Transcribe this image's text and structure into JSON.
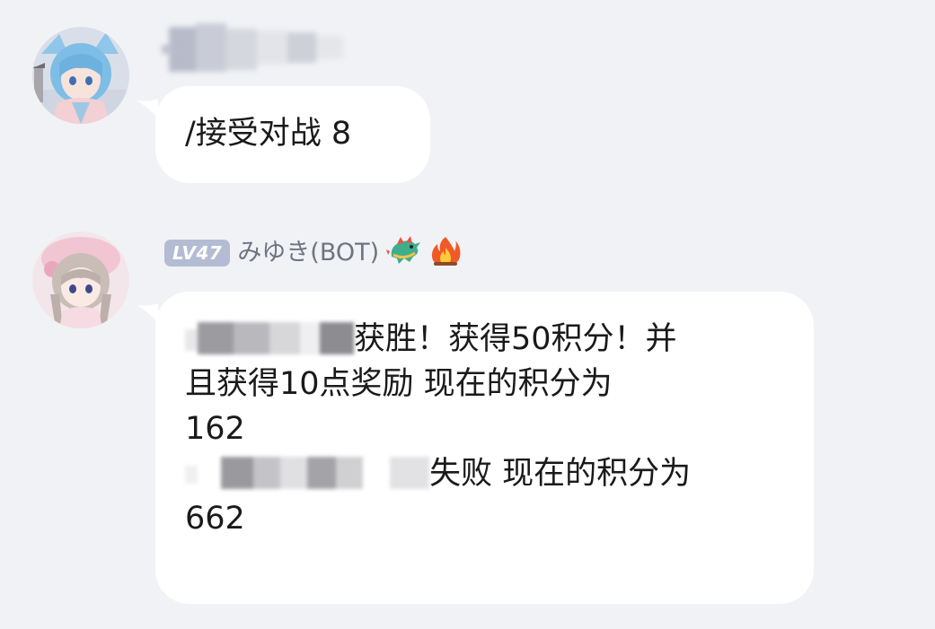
{
  "messages": [
    {
      "text": "/接受对战 8"
    },
    {
      "level_badge": "LV47",
      "sender": "みゆき(BOT)",
      "badge_icons": [
        "dragon-icon",
        "fire-icon"
      ],
      "line1": "获胜！获得50积分！并",
      "line2": "且获得10点奖励 现在的积分为",
      "line3": "162",
      "line4": "失败 现在的积分为",
      "line5": "662"
    }
  ],
  "colors": {
    "background": "#f1f2f6",
    "bubble": "#ffffff",
    "level_badge": "#b4bcd3",
    "sender_name": "#6f7382"
  }
}
